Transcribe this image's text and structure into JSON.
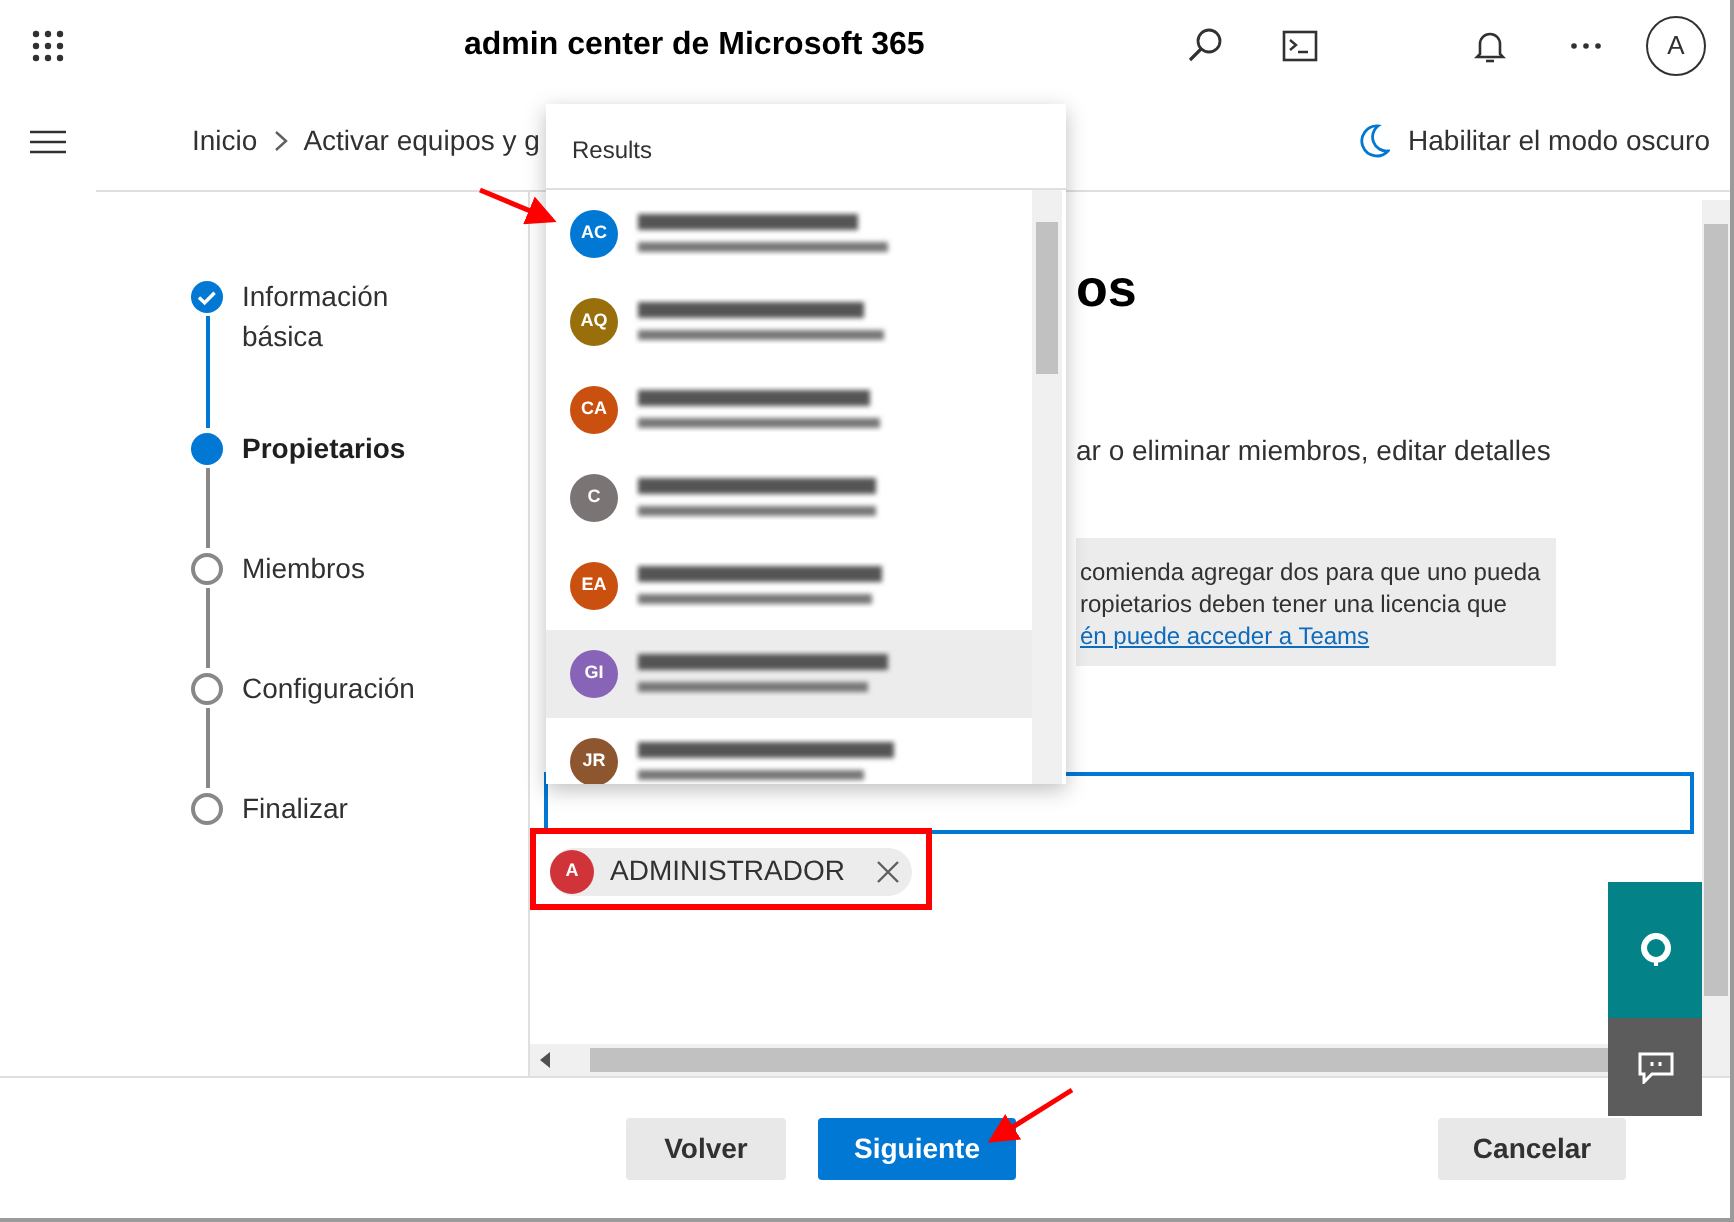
{
  "header": {
    "title": "admin center de Microsoft 365",
    "avatar": "A"
  },
  "breadcrumb": [
    "Inicio",
    "Activar equipos y g"
  ],
  "dark_mode_toggle": {
    "label": "Habilitar el modo oscuro"
  },
  "steps": [
    {
      "label": "Información básica",
      "completed": true,
      "selected": false
    },
    {
      "label": "Propietarios",
      "completed": false,
      "selected": true
    },
    {
      "label": "Miembros",
      "completed": false,
      "selected": false
    },
    {
      "label": "Configuración",
      "completed": false,
      "selected": false
    },
    {
      "label": "Finalizar",
      "completed": false,
      "selected": false
    }
  ],
  "content": {
    "heading_fragment": "os",
    "description_fragment": "ar o eliminar miembros, editar detalles",
    "info_lines": [
      {
        "kind": "text",
        "text": "comienda agregar dos para que uno pueda"
      },
      {
        "kind": "text",
        "text": "ropietarios deben tener una licencia que"
      },
      {
        "kind": "link",
        "text": "én puede acceder a Teams"
      }
    ]
  },
  "owner_search": {
    "results_header": "Results",
    "results": [
      {
        "initials": "AC",
        "color": "#0078d4",
        "highlighted": false
      },
      {
        "initials": "AQ",
        "color": "#986f0b",
        "highlighted": false
      },
      {
        "initials": "CA",
        "color": "#ca5010",
        "highlighted": false
      },
      {
        "initials": "C",
        "color": "#7a7574",
        "highlighted": false
      },
      {
        "initials": "EA",
        "color": "#ca5010",
        "highlighted": false
      },
      {
        "initials": "GI",
        "color": "#8764b8",
        "highlighted": true
      },
      {
        "initials": "JR",
        "color": "#8e562e",
        "highlighted": false
      }
    ]
  },
  "selected_owners": [
    {
      "initials": "A",
      "name": "ADMINISTRADOR",
      "color": "#d13438"
    }
  ],
  "buttons": [
    {
      "label": "Volver",
      "kind": "secondary"
    },
    {
      "label": "Siguiente",
      "kind": "primary"
    },
    {
      "label": "Cancelar",
      "kind": "cancel"
    }
  ]
}
